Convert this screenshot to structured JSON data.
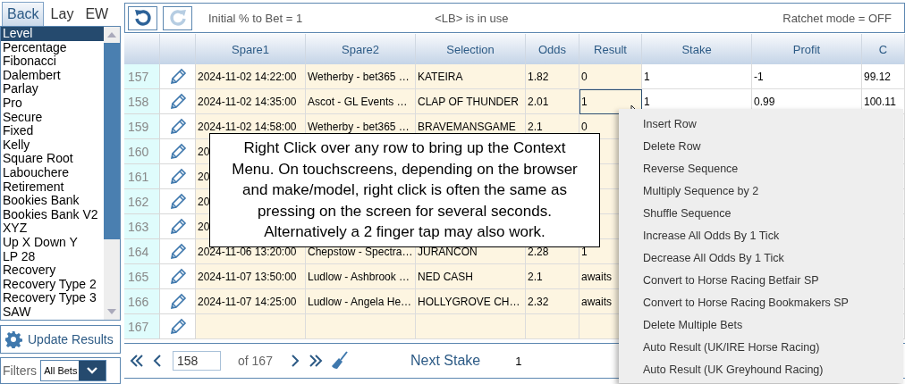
{
  "sidebar": {
    "tabs": [
      {
        "label": "Back",
        "selected": true
      },
      {
        "label": "Lay",
        "selected": false
      },
      {
        "label": "EW",
        "selected": false
      }
    ],
    "strategies": [
      {
        "label": "Level",
        "selected": true
      },
      {
        "label": "Percentage",
        "selected": false
      },
      {
        "label": "Fibonacci",
        "selected": false
      },
      {
        "label": "Dalembert",
        "selected": false
      },
      {
        "label": "Parlay",
        "selected": false
      },
      {
        "label": "Pro",
        "selected": false
      },
      {
        "label": "Secure",
        "selected": false
      },
      {
        "label": "Fixed",
        "selected": false
      },
      {
        "label": "Kelly",
        "selected": false
      },
      {
        "label": "Square Root",
        "selected": false
      },
      {
        "label": "Labouchere",
        "selected": false
      },
      {
        "label": "Retirement",
        "selected": false
      },
      {
        "label": "Bookies Bank",
        "selected": false
      },
      {
        "label": "Bookies Bank V2",
        "selected": false
      },
      {
        "label": "XYZ",
        "selected": false
      },
      {
        "label": "Up X Down Y",
        "selected": false
      },
      {
        "label": "LP 28",
        "selected": false
      },
      {
        "label": "Recovery",
        "selected": false
      },
      {
        "label": "Recovery Type 2",
        "selected": false
      },
      {
        "label": "Recovery Type 3",
        "selected": false
      },
      {
        "label": "SAW",
        "selected": false
      }
    ],
    "update_button": "Update Results",
    "filters": {
      "label": "Filters",
      "value": "All Bets"
    }
  },
  "toolbar": {
    "buttons": [
      {
        "kind": "undo",
        "disabled": false
      },
      {
        "kind": "redo",
        "disabled": true
      }
    ],
    "initial": "Initial % to Bet = 1",
    "lb_status": "<LB> is in use",
    "ratchet": "Ratchet mode = OFF"
  },
  "table": {
    "columns": [
      "Spare1",
      "Spare2",
      "Selection",
      "Odds",
      "Result",
      "Stake",
      "Profit",
      "C"
    ],
    "rows": [
      {
        "number": "157",
        "spare1": "2024-11-02 14:22:00",
        "spare2": "Wetherby - bet365 …",
        "selection": "KATEIRA",
        "odds": "1.82",
        "result": "0",
        "stake": "1",
        "profit": "-1",
        "column_10": "99.12",
        "selected": false
      },
      {
        "number": "158",
        "spare1": "2024-11-02 14:35:00",
        "spare2": "Ascot - GL Events …",
        "selection": "CLAP OF THUNDER",
        "odds": "2.01",
        "result": "1",
        "stake": "1",
        "profit": "0.99",
        "column_10": "100.11",
        "selected": true
      },
      {
        "number": "159",
        "spare1": "2024-11-02 14:58:00",
        "spare2": "Wetherby - bet365 …",
        "selection": "BRAVEMANSGAME",
        "odds": "2.1",
        "result": "0",
        "selected": false
      },
      {
        "number": "160",
        "spare1": "20",
        "selected": false
      },
      {
        "number": "161",
        "spare1": "20",
        "selected": false
      },
      {
        "number": "162",
        "spare1": "20",
        "selected": false
      },
      {
        "number": "163",
        "spare1": "20",
        "selected": false
      },
      {
        "number": "164",
        "spare1": "2024-11-06 13:20:00",
        "spare2": "Chepstow - Spectra…",
        "selection": "JURANCON",
        "odds": "2.28",
        "result": "1",
        "selected": false
      },
      {
        "number": "165",
        "spare1": "2024-11-07 13:50:00",
        "spare2": "Ludlow - Ashbrook …",
        "selection": "NED CASH",
        "odds": "2.1",
        "result": "awaits",
        "selected": false
      },
      {
        "number": "166",
        "spare1": "2024-11-07 14:25:00",
        "spare2": "Ludlow - Angela He…",
        "selection": "HOLLYGROVE CH…",
        "odds": "2.32",
        "result": "awaits",
        "selected": false
      },
      {
        "number": "167",
        "selected": false
      }
    ]
  },
  "pager": {
    "page": "158",
    "total": "of 167",
    "next_stake_label": "Next Stake",
    "next_stake": "1"
  },
  "tooltip": "Right Click over any row to bring up the Context Menu. On touchscreens, depending on the browser and make/model, right click is often the same as pressing on the screen for several seconds. Alternatively a 2 finger tap may also work.",
  "context_menu": [
    "Insert Row",
    "Delete Row",
    "Reverse Sequence",
    "Multiply Sequence by 2",
    "Shuffle Sequence",
    "Increase All Odds By 1 Tick",
    "Decrease All Odds By 1 Tick",
    "Convert to Horse Racing Betfair SP",
    "Convert to Horse Racing Bookmakers SP",
    "Delete Multiple Bets",
    "Auto Result (UK/IRE Horse Racing)",
    "Auto Result (UK Greyhound Racing)"
  ]
}
